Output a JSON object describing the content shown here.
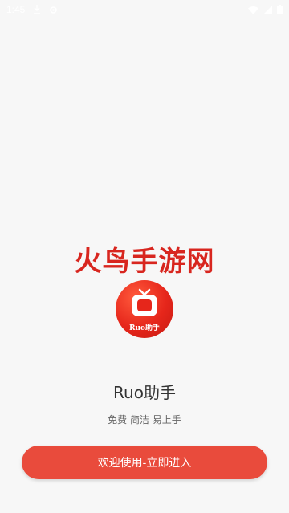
{
  "status_bar": {
    "time": "1:45",
    "icons": [
      "download-icon",
      "settings-icon",
      "wifi-icon",
      "signal-icon",
      "battery-icon"
    ]
  },
  "watermark": "火鸟手游网",
  "app": {
    "logo_text": "Ruo助手",
    "name": "Ruo助手",
    "tagline": "免费 简洁 易上手"
  },
  "enter_button": {
    "label": "欢迎使用-立即进入"
  },
  "colors": {
    "background": "#f7f7f7",
    "accent": "#e94b3c",
    "watermark": "#d8261f"
  }
}
